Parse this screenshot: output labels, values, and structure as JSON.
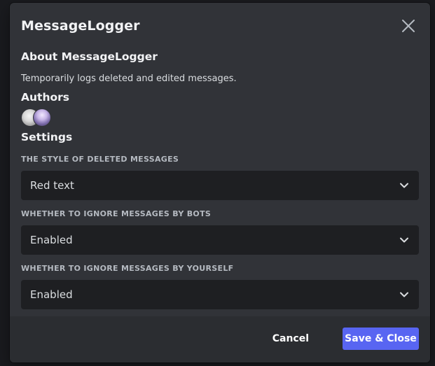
{
  "modal": {
    "title": "MessageLogger"
  },
  "about": {
    "title": "About MessageLogger",
    "description": "Temporarily logs deleted and edited messages."
  },
  "authors": {
    "title": "Authors",
    "avatars": [
      "author-avatar-1",
      "author-avatar-2"
    ]
  },
  "settings": {
    "title": "Settings",
    "fields": [
      {
        "label": "THE STYLE OF DELETED MESSAGES",
        "value": "Red text"
      },
      {
        "label": "WHETHER TO IGNORE MESSAGES BY BOTS",
        "value": "Enabled"
      },
      {
        "label": "WHETHER TO IGNORE MESSAGES BY YOURSELF",
        "value": "Enabled"
      }
    ]
  },
  "footer": {
    "cancel_label": "Cancel",
    "save_label": "Save & Close"
  },
  "colors": {
    "background": "#313338",
    "footer": "#2b2d31",
    "input": "#1e1f22",
    "accent": "#5865f2"
  },
  "icons": {
    "close": "close-icon",
    "chevron": "chevron-down-icon"
  }
}
